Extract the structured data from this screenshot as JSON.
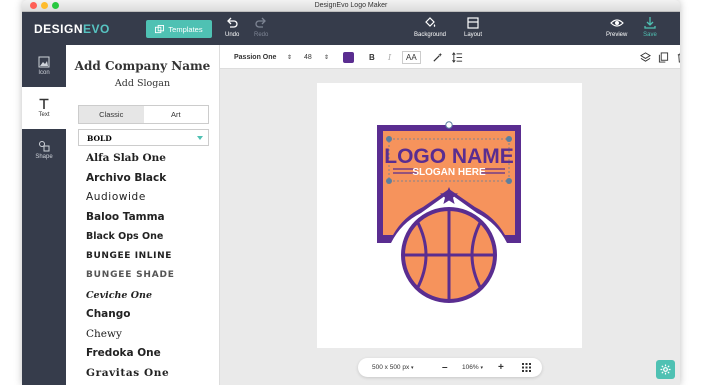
{
  "window": {
    "title": "DesignEvo Logo Maker"
  },
  "brand": {
    "part1": "DESIGN",
    "part2": "EVO"
  },
  "topbar": {
    "templates_label": "Templates",
    "undo_label": "Undo",
    "redo_label": "Redo",
    "background_label": "Background",
    "layout_label": "Layout",
    "preview_label": "Preview",
    "save_label": "Save"
  },
  "leftnav": {
    "icon_label": "Icon",
    "text_label": "Text",
    "shape_label": "Shape"
  },
  "panel": {
    "company_name": "Add Company Name",
    "slogan": "Add Slogan",
    "tab_classic": "Classic",
    "tab_art": "Art",
    "font_filter": "BOLD",
    "fonts": [
      "Alfa Slab One",
      "Archivo Black",
      "Audiowide",
      "Baloo Tamma",
      "Black Ops One",
      "BUNGEE INLINE",
      "BUNGEE SHADE",
      "Ceviche One",
      "Chango",
      "Chewy",
      "Fredoka One",
      "Gravitas One"
    ]
  },
  "toolbar": {
    "font_name": "Passion One",
    "font_size": "48",
    "bold": "B",
    "italic": "I",
    "case": "AA"
  },
  "logo": {
    "name": "LOGO NAME",
    "slogan": "SLOGAN HERE"
  },
  "bottombar": {
    "canvas_size": "500 x 500 px",
    "zoom": "106%"
  },
  "colors": {
    "dark": "#363c4b",
    "accent": "#4fc1b3",
    "purple": "#5a2d90",
    "orange": "#f6935c"
  }
}
